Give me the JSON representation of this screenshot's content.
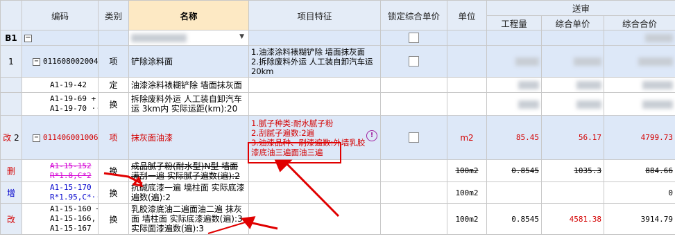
{
  "headers": {
    "code": "编码",
    "type": "类别",
    "name": "名称",
    "feature": "项目特征",
    "lock_price": "锁定综合单价",
    "unit": "单位",
    "review": "送审",
    "qty": "工程量",
    "unit_price": "综合单价",
    "total": "综合合价"
  },
  "rows": {
    "b1": {
      "label": "B1",
      "toggle": "−"
    },
    "r1": {
      "num": "1",
      "code": "011608002004",
      "type": "项",
      "name": "铲除涂料面",
      "feature": "1.油漆涂料裱糊铲除 墙面抹灰面\n2.拆除废料外运 人工装自卸汽车运20km"
    },
    "r1a": {
      "code": "A1-19-42",
      "type": "定",
      "name": "油漆涂料裱糊铲除 墙面抹灰面"
    },
    "r1b": {
      "code": "A1-19-69 +\nA1-19-70 ···",
      "type": "换",
      "name": "拆除废料外运 人工装自卸汽车运 3km内  实际运距(km):20"
    },
    "r2": {
      "status": "改",
      "num": "2",
      "code": "011406001006",
      "type": "项",
      "name": "抹灰面油漆",
      "feature": "1.腻子种类:耐水腻子粉\n2.刮腻子遍数:2遍\n3.油漆品种、刷漆遍数:外墙乳胶漆底油三遍面油三遍",
      "unit": "m2",
      "qty": "85.45",
      "unit_price": "56.17",
      "total": "4799.73",
      "warn": "!"
    },
    "r2a": {
      "status": "删",
      "code": "A1-15-152\nR*1.8,C*2",
      "type": "换",
      "name": "成品腻子粉(耐水型)N型  墙面满刮一遍  实际腻子遍数(遍):2",
      "unit": "100m2",
      "qty": "0.8545",
      "unit_price": "1035.3",
      "total": "884.66"
    },
    "r2b": {
      "status": "增",
      "code": "A1-15-170\nR*1.95,C*···",
      "type": "换",
      "name": "抗碱底漆一遍  墙柱面  实际底漆遍数(遍):2",
      "unit": "100m2",
      "total": "0"
    },
    "r2c": {
      "status": "改",
      "code": "A1-15-160 +\nA1-15-166, +\nA1-15-167",
      "type": "换",
      "name": "乳胶漆底油二遍面油二遍  抹灰面  墙柱面  实际底漆遍数(遍):3  实际面漆遍数(遍):3",
      "unit": "100m2",
      "qty": "0.8545",
      "unit_price": "4581.38",
      "total": "3914.79"
    }
  },
  "colors": {
    "annotation": "#e00000",
    "changed_text": "#d40000",
    "added_text": "#0000cc",
    "header_bg": "#e4ecf7",
    "name_header_bg": "#fde9c4",
    "selected_row_bg": "#dde8f8"
  }
}
